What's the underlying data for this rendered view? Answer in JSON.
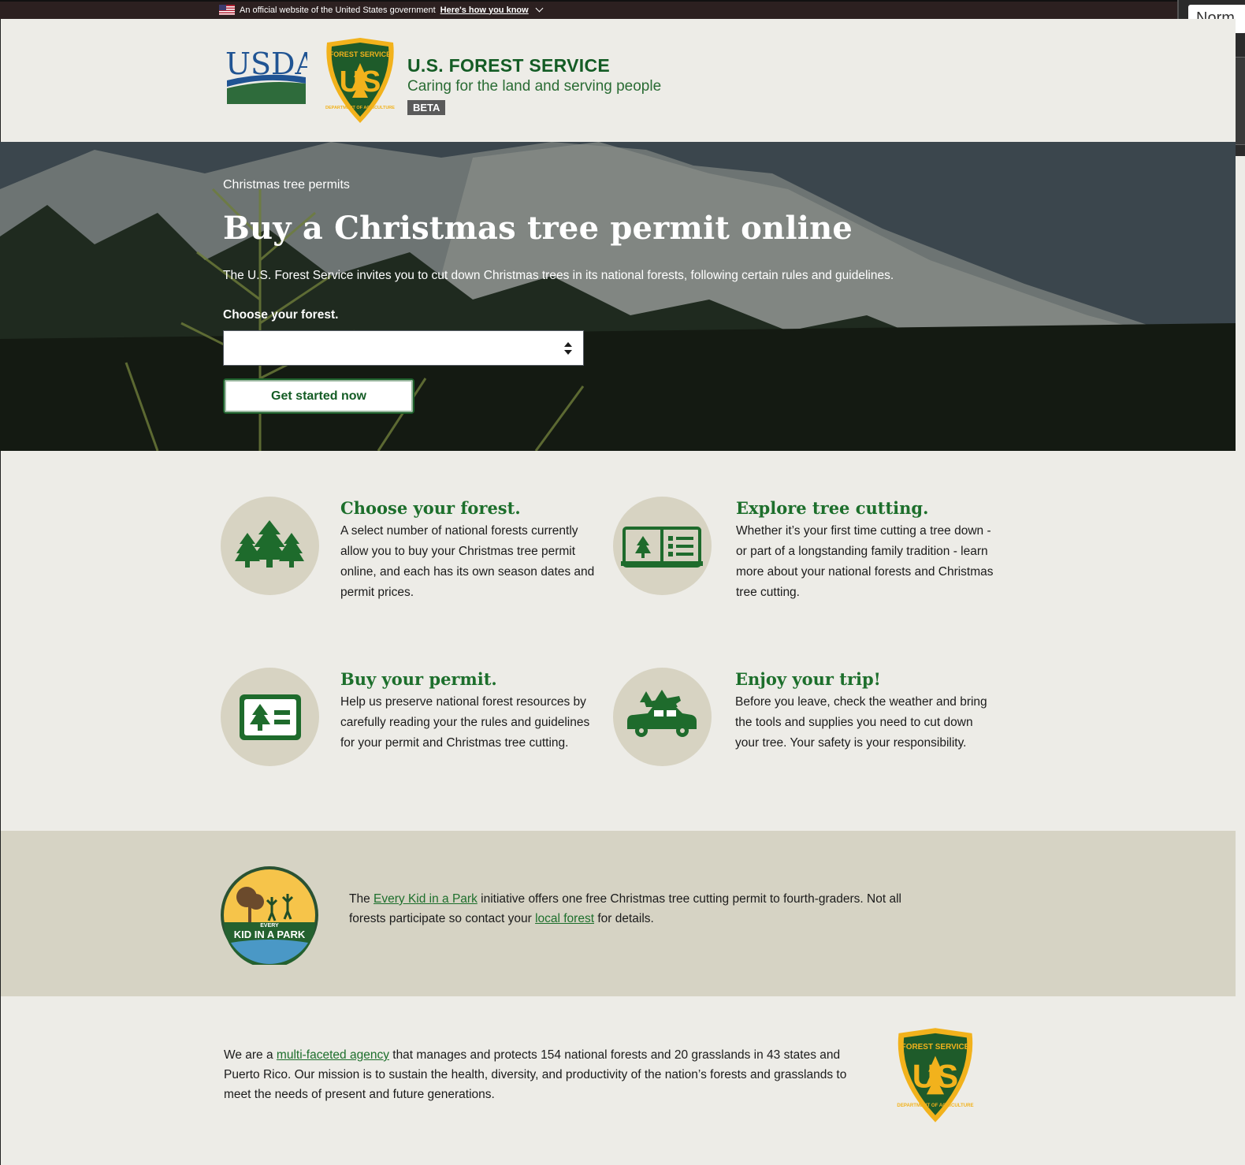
{
  "gov_banner": {
    "text": "An official website of the United States government",
    "link": "Here's how you know"
  },
  "header": {
    "usda_logo_text": "USDA",
    "shield_text_top": "FOREST SERVICE",
    "shield_text_mid": "US",
    "shield_text_bottom": "DEPARTMENT OF AGRICULTURE",
    "title": "U.S. FOREST SERVICE",
    "tagline": "Caring for the land and serving people",
    "badge": "BETA"
  },
  "side_panel": {
    "select_text": "Norm"
  },
  "hero": {
    "breadcrumb": "Christmas tree permits",
    "title": "Buy a Christmas tree permit online",
    "lead": "The U.S. Forest Service invites you to cut down Christmas trees in its national forests, following certain rules and guidelines.",
    "select_label": "Choose your forest.",
    "select_value": "",
    "button": "Get started now"
  },
  "steps": [
    {
      "icon": "trees-icon",
      "title": "Choose your forest.",
      "body": "A select number of national forests currently allow you to buy your Christmas tree permit online, and each has its own season dates and permit prices."
    },
    {
      "icon": "guide-book-icon",
      "title": "Explore tree cutting.",
      "body": "Whether it’s your first time cutting a tree down - or part of a longstanding family tradition - learn more about your national forests and Christmas tree cutting."
    },
    {
      "icon": "permit-card-icon",
      "title": "Buy your permit.",
      "body": "Help us preserve national forest resources by carefully reading your the rules and guidelines for your permit and Christmas tree cutting."
    },
    {
      "icon": "car-with-tree-icon",
      "title": "Enjoy your trip!",
      "body": "Before you leave, check the weather and bring the tools and supplies you need to cut down your tree. Your safety is your responsibility."
    }
  ],
  "kid": {
    "logo_text_small": "EVERY",
    "logo_text": "KID IN A PARK",
    "pre": "The ",
    "link1": "Every Kid in a Park",
    "mid": " initiative offers one free Christmas tree cutting permit to fourth-graders. Not all forests participate so contact your ",
    "link2": "local forest",
    "post": " for details."
  },
  "footer": {
    "pre": "We are a ",
    "link": "multi-faceted agency",
    "post": " that manages and protects 154 national forests and 20 grasslands in 43 states and Puerto Rico. Our mission is to sustain the health, diversity, and productivity of the nation’s forests and grasslands to meet the needs of present and future generations."
  },
  "colors": {
    "brand_green": "#145c25",
    "heading_green": "#1d6f2c",
    "shield_gold": "#f2b21c",
    "circle_beige": "#d7d3c2",
    "page_bg": "#edece7",
    "kid_bg": "#d6d3c4"
  }
}
